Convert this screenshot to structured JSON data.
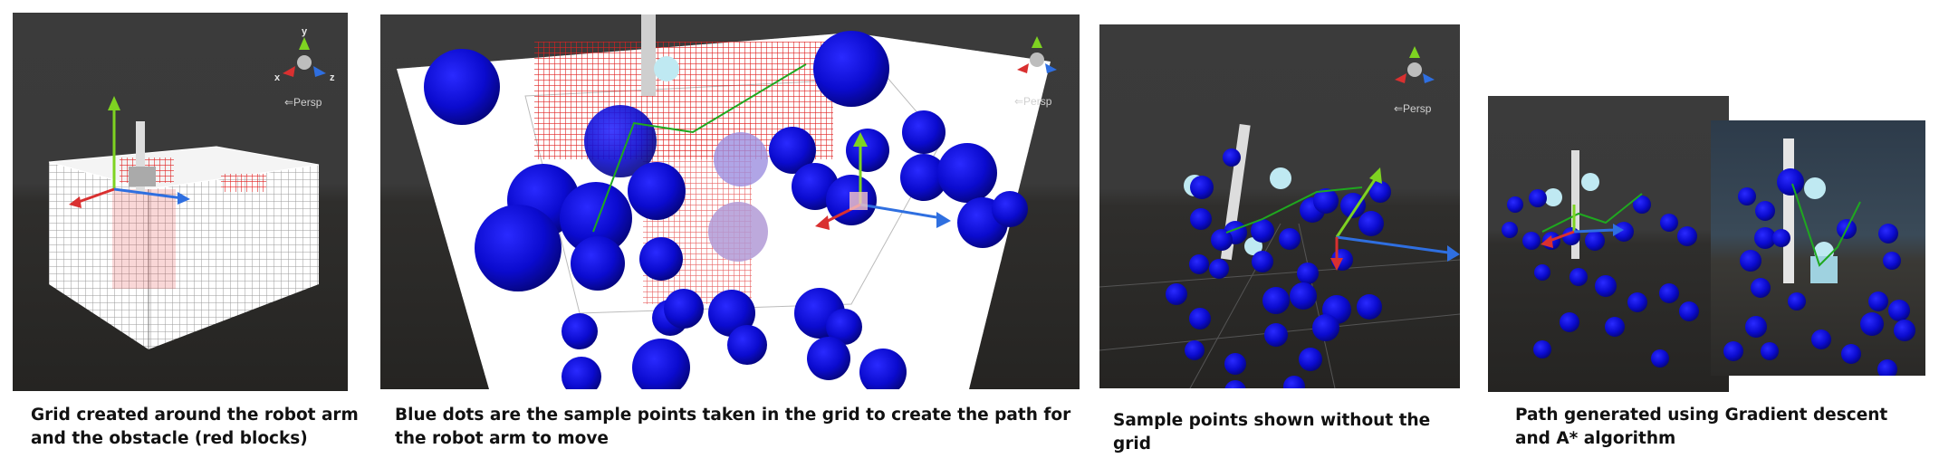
{
  "panels": [
    {
      "caption": "Grid created around the robot arm and the obstacle (red blocks)"
    },
    {
      "caption": "Blue dots are the sample points taken in the grid to create the path for the robot arm to move"
    },
    {
      "caption": "Sample points shown without the grid"
    },
    {
      "caption": "Path generated using Gradient descent and A* algorithm"
    }
  ],
  "scene": {
    "persp_label": "⇐Persp",
    "axes": {
      "x": "x",
      "y": "y",
      "z": "z"
    },
    "colors": {
      "sky": "#3a3a3a",
      "ground": "#2b2a28",
      "grid_line": "#ffffff",
      "obstacle": "#e02020",
      "sample_point": "#0a0ad0",
      "path": "#1fa81f",
      "axis_x": "#d93030",
      "axis_y": "#7ed321",
      "axis_z": "#2f6fe0"
    }
  }
}
